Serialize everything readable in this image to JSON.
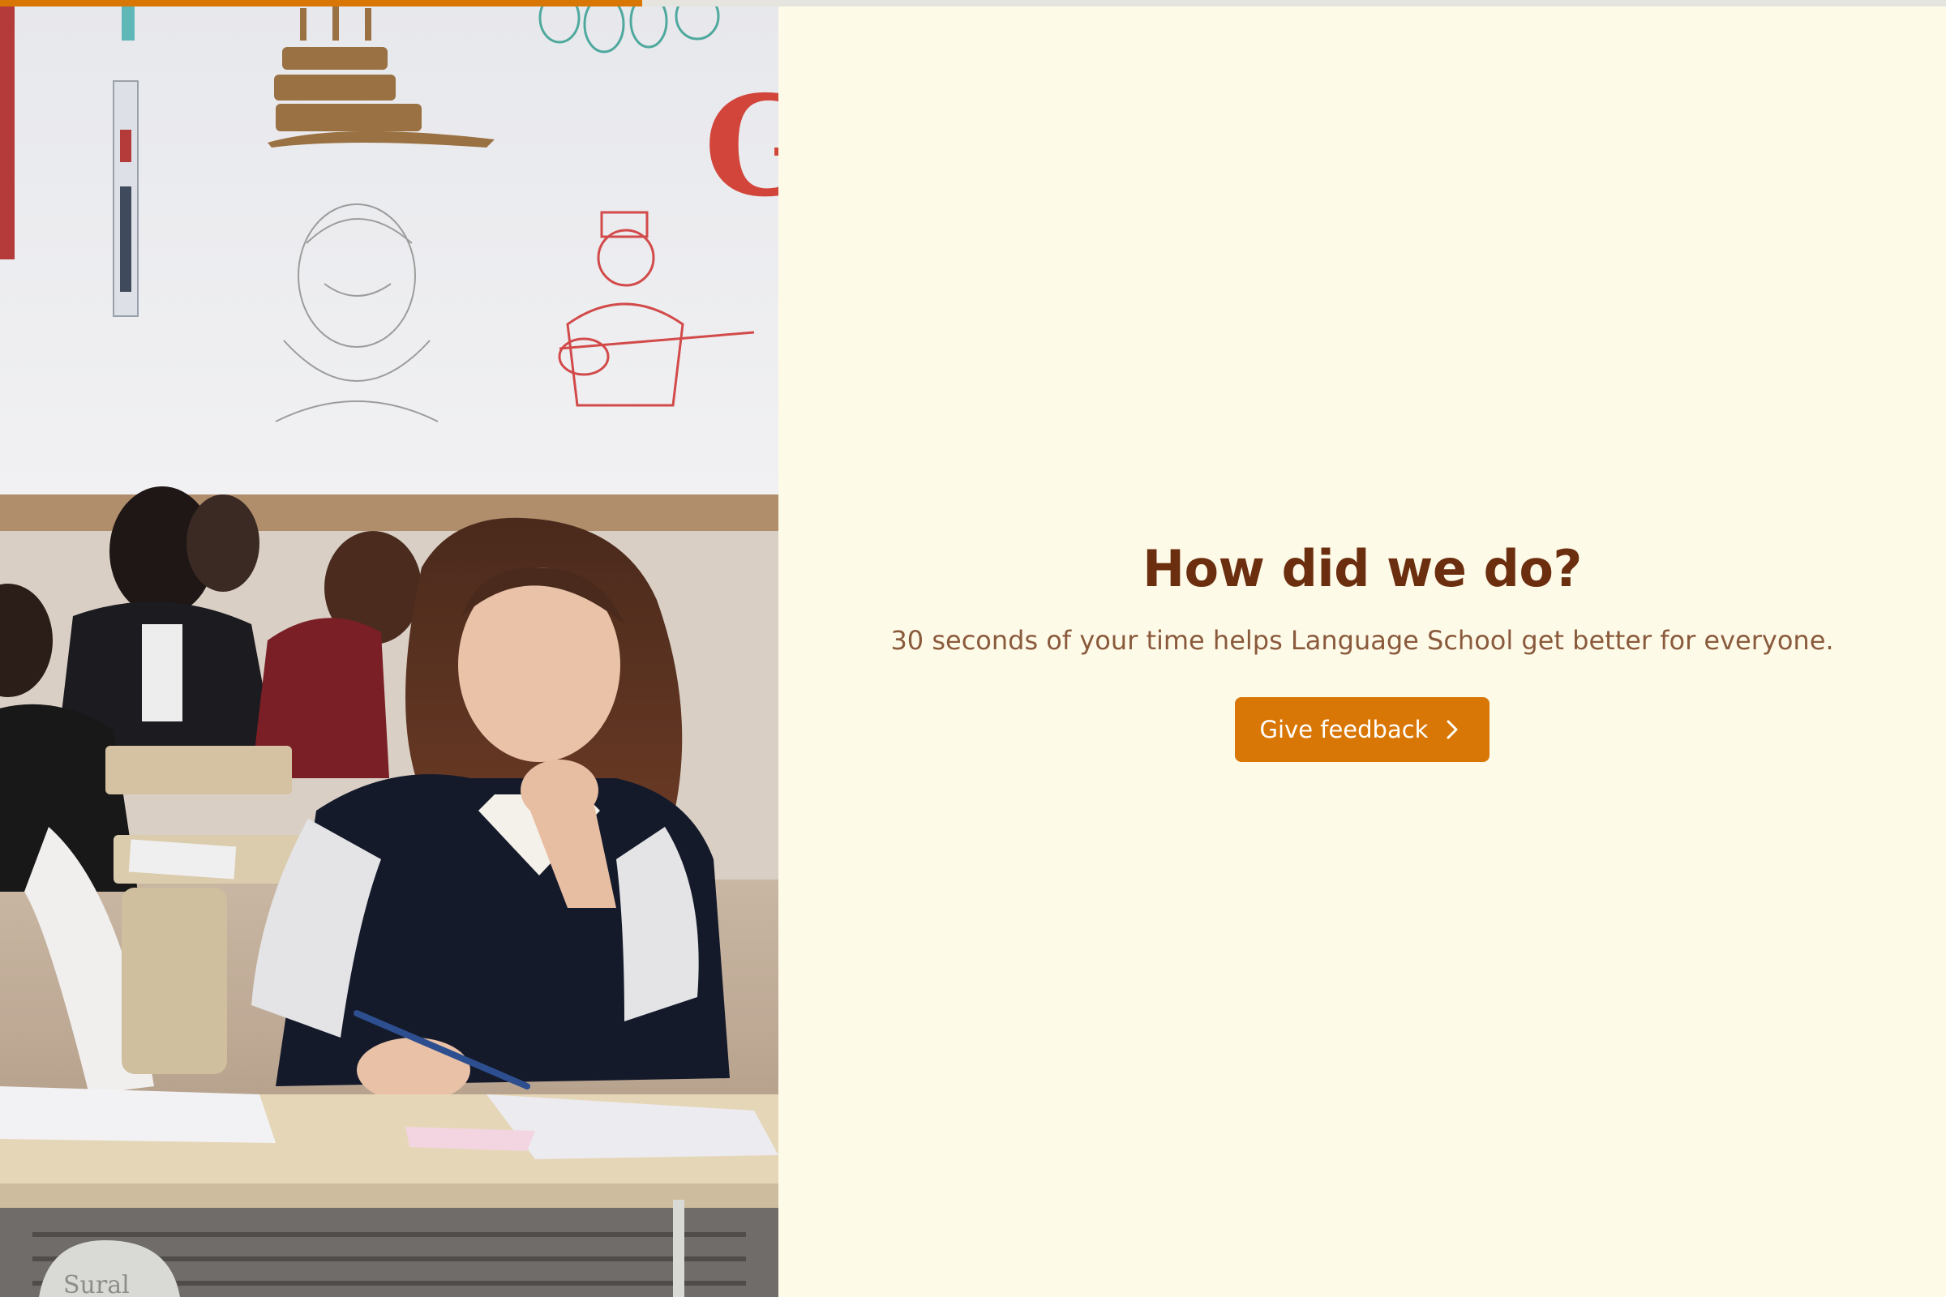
{
  "progress": {
    "fraction": 0.33
  },
  "hero": {
    "alt": "Students writing at desks in a classroom",
    "wall_letter": "G",
    "desk_brand": "Sural"
  },
  "main": {
    "title": "How did we do?",
    "subtitle": "30 seconds of your time helps Language School get better for everyone.",
    "cta_label": "Give feedback",
    "cta_icon": "chevron-right-icon"
  },
  "colors": {
    "accent": "#D97706",
    "title": "#6B2E0E",
    "subtitle": "#8A5A3C",
    "background": "#FEFAE8"
  }
}
